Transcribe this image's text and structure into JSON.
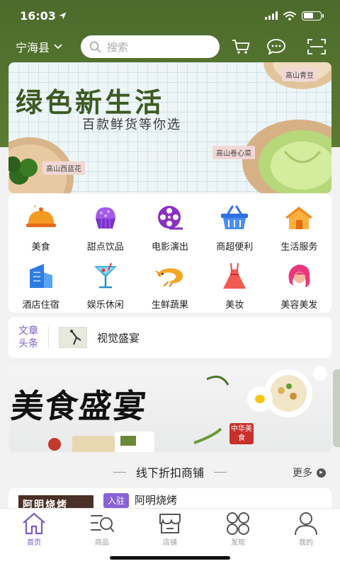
{
  "status_bar": {
    "time": "16:03"
  },
  "header": {
    "location": "宁海县",
    "search_placeholder": "搜索"
  },
  "hero_banner": {
    "title": "绿色新生活",
    "subtitle": "百款鲜货等你选",
    "tags": [
      "高山青豆",
      "高山卷心菜",
      "高山西蓝花"
    ]
  },
  "categories": [
    {
      "label": "美食",
      "icon": "food-cloche-icon"
    },
    {
      "label": "甜点饮品",
      "icon": "cake-icon"
    },
    {
      "label": "电影演出",
      "icon": "film-reel-icon"
    },
    {
      "label": "商超便利",
      "icon": "shopping-basket-icon"
    },
    {
      "label": "生活服务",
      "icon": "house-icon"
    },
    {
      "label": "酒店住宿",
      "icon": "hotel-building-icon"
    },
    {
      "label": "娱乐休闲",
      "icon": "cocktail-icon"
    },
    {
      "label": "生鲜蔬果",
      "icon": "shrimp-icon"
    },
    {
      "label": "美妆",
      "icon": "dress-icon"
    },
    {
      "label": "美容美发",
      "icon": "hair-woman-icon"
    }
  ],
  "headline": {
    "tag_line1": "文章",
    "tag_line2": "头条",
    "text": "视觉盛宴"
  },
  "promo_banner": {
    "title": "美食盛宴",
    "stamp": "中华美食"
  },
  "section": {
    "title": "线下折扣商铺",
    "more": "更多"
  },
  "shop": {
    "thumb_text": "阿明烧烤",
    "badge": "入驻",
    "name": "阿明烧烤"
  },
  "tabbar": [
    {
      "label": "首页",
      "icon": "home-icon",
      "active": true
    },
    {
      "label": "商品",
      "icon": "goods-search-icon",
      "active": false
    },
    {
      "label": "店铺",
      "icon": "store-icon",
      "active": false
    },
    {
      "label": "发现",
      "icon": "discover-icon",
      "active": false
    },
    {
      "label": "我的",
      "icon": "profile-icon",
      "active": false
    }
  ],
  "colors": {
    "header_green": "#56752f",
    "accent_purple": "#7c5bc4"
  }
}
